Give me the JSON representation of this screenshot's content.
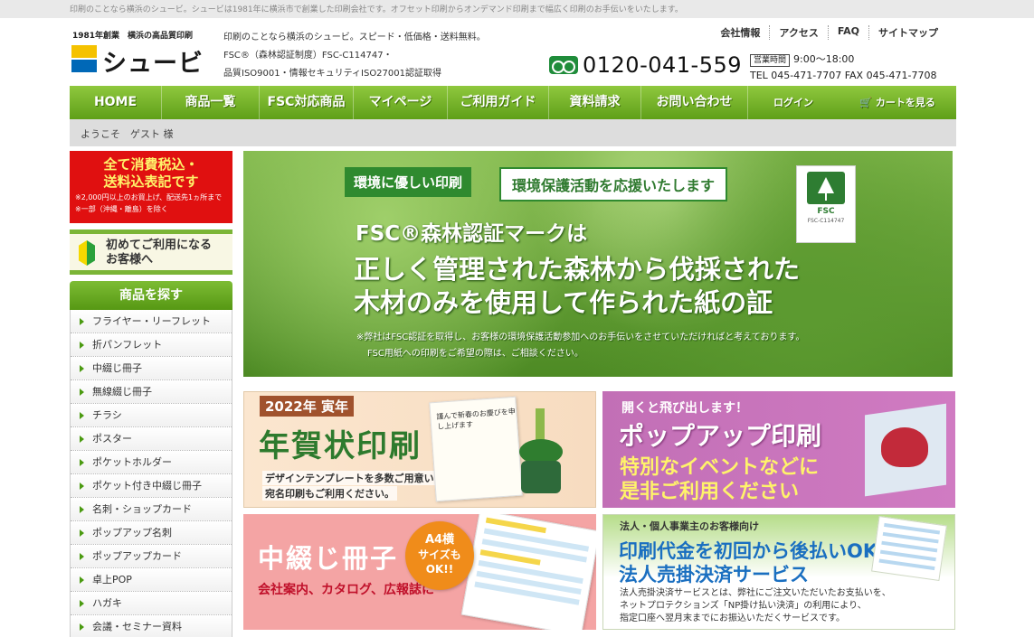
{
  "topbar": {
    "text": "印刷のことなら横浜のシュービ。シュービは1981年に横浜市で創業した印刷会社です。オフセット印刷からオンデマンド印刷まで幅広く印刷のお手伝いをいたします。"
  },
  "header": {
    "logo_tag": "1981年創業　横浜の高品質印刷",
    "logo_name": "シュービ",
    "intro": [
      "印刷のことなら横浜のシュービ。スピード・低価格・送料無料。",
      "FSC®（森林認証制度）FSC-C114747・",
      "品質ISO9001・情報セキュリティISO27001認証取得"
    ],
    "links": [
      "会社情報",
      "アクセス",
      "FAQ",
      "サイトマップ"
    ],
    "phone": "0120-041-559",
    "hours_label": "営業時間",
    "hours": "9:00～18:00",
    "tel_fax": "TEL 045-471-7707  FAX 045-471-7708"
  },
  "nav": {
    "items": [
      "HOME",
      "商品一覧",
      "FSC対応商品",
      "マイページ",
      "ご利用ガイド",
      "資料請求",
      "お問い合わせ",
      "ログイン",
      "カートを見る"
    ]
  },
  "welcome": "ようこそ　ゲスト 様",
  "sidebar": {
    "tax_line1": "全て消費税込・",
    "tax_line2": "送料込表記です",
    "tax_note1": "※2,000円以上のお買上げ、配送先1ヵ所まで",
    "tax_note2": "※一部（沖縄・離島）を除く",
    "first_line1": "初めてご利用になる",
    "first_line2": "お客様へ",
    "category_header": "商品を探す",
    "categories": [
      "フライヤー・リーフレット",
      "折パンフレット",
      "中綴じ冊子",
      "無線綴じ冊子",
      "チラシ",
      "ポスター",
      "ポケットホルダー",
      "ポケット付き中綴じ冊子",
      "名刺・ショップカード",
      "ポップアップ名刺",
      "ポップアップカード",
      "卓上POP",
      "ハガキ",
      "会議・セミナー資料"
    ]
  },
  "hero": {
    "tag": "環境に優しい印刷",
    "subtag": "環境保護活動を応援いたします",
    "lead": "FSC®森林認証マークは",
    "main1": "正しく管理された森林から伐採された",
    "main2": "木材のみを使用して作られた紙の証",
    "note1": "※弊社はFSC認証を取得し、お客様の環境保護活動参加へのお手伝いをさせていただければと考えております。",
    "note2": "FSC用紙への印刷をご希望の際は、ご相談ください。",
    "badge_label": "FSC",
    "badge_code": "FSC-C114747"
  },
  "promos": {
    "p1": {
      "title": "2022年 寅年",
      "main": "年賀状印刷",
      "sub1": "デザインテンプレートを多数ご用意いたしました。",
      "sub2": "宛名印刷もご利用ください。",
      "card_text": "謹んで新春のお慶びを申し上げます"
    },
    "p2": {
      "lead": "開くと飛び出します！",
      "title": "ポップアップ印刷",
      "sub1": "特別なイベントなどに",
      "sub2": "是非ご利用ください"
    },
    "p3": {
      "title": "中綴じ冊子",
      "sub": "会社案内、カタログ、広報誌に",
      "badge1": "A4横",
      "badge2": "サイズも",
      "badge3": "OK!!"
    },
    "p4": {
      "lead": "法人・個人事業主のお客様向け",
      "title1": "印刷代金を初回から後払いOK！",
      "title2": "法人売掛決済サービス",
      "desc1": "法人売掛決済サービスとは、弊社にご注文いただいたお支払いを、",
      "desc2": "ネットプロテクションズ「NP掛け払い決済」の利用により、",
      "desc3": "指定口座へ翌月末までにお振込いただくサービスです。"
    }
  },
  "colors": {
    "nav_green": "#5f9f18",
    "accent_red": "#e01010",
    "brand_blue": "#0068b7",
    "brand_yellow": "#f5c200"
  }
}
